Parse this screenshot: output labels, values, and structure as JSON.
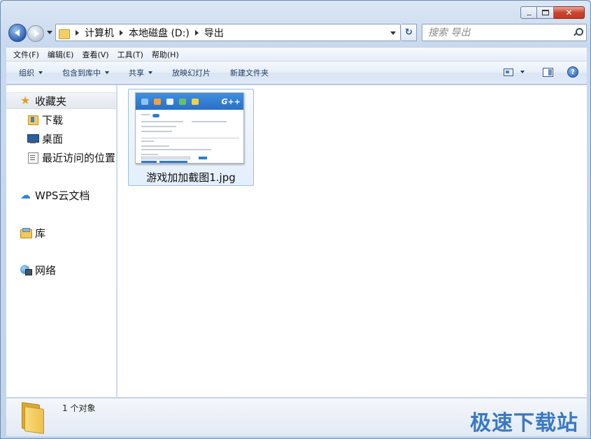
{
  "window": {
    "caption": {
      "minimize": "",
      "maximize": "",
      "close": "✕"
    }
  },
  "address": {
    "crumbs": [
      "计算机",
      "本地磁盘 (D:)",
      "导出"
    ]
  },
  "search": {
    "placeholder": "搜索 导出"
  },
  "menu": {
    "items": [
      "文件(F)",
      "编辑(E)",
      "查看(V)",
      "工具(T)",
      "帮助(H)"
    ]
  },
  "commands": {
    "organize": "组织",
    "include_in_library": "包含到库中",
    "share": "共享",
    "slideshow": "放映幻灯片",
    "new_folder": "新建文件夹",
    "help": "?"
  },
  "nav_pane": {
    "favorites": "收藏夹",
    "downloads": "下载",
    "desktop": "桌面",
    "recent": "最近访问的位置",
    "wps": "WPS云文档",
    "libraries": "库",
    "network": "网络"
  },
  "files": [
    {
      "name": "游戏加加截图1.jpg",
      "thumb_logo": "G++"
    }
  ],
  "status": {
    "count": "1 个对象"
  },
  "watermark": "极速下载站",
  "colors": {
    "accent": "#2d7ad6",
    "selection": "#e3effb",
    "watermark": "#3a78c4"
  }
}
